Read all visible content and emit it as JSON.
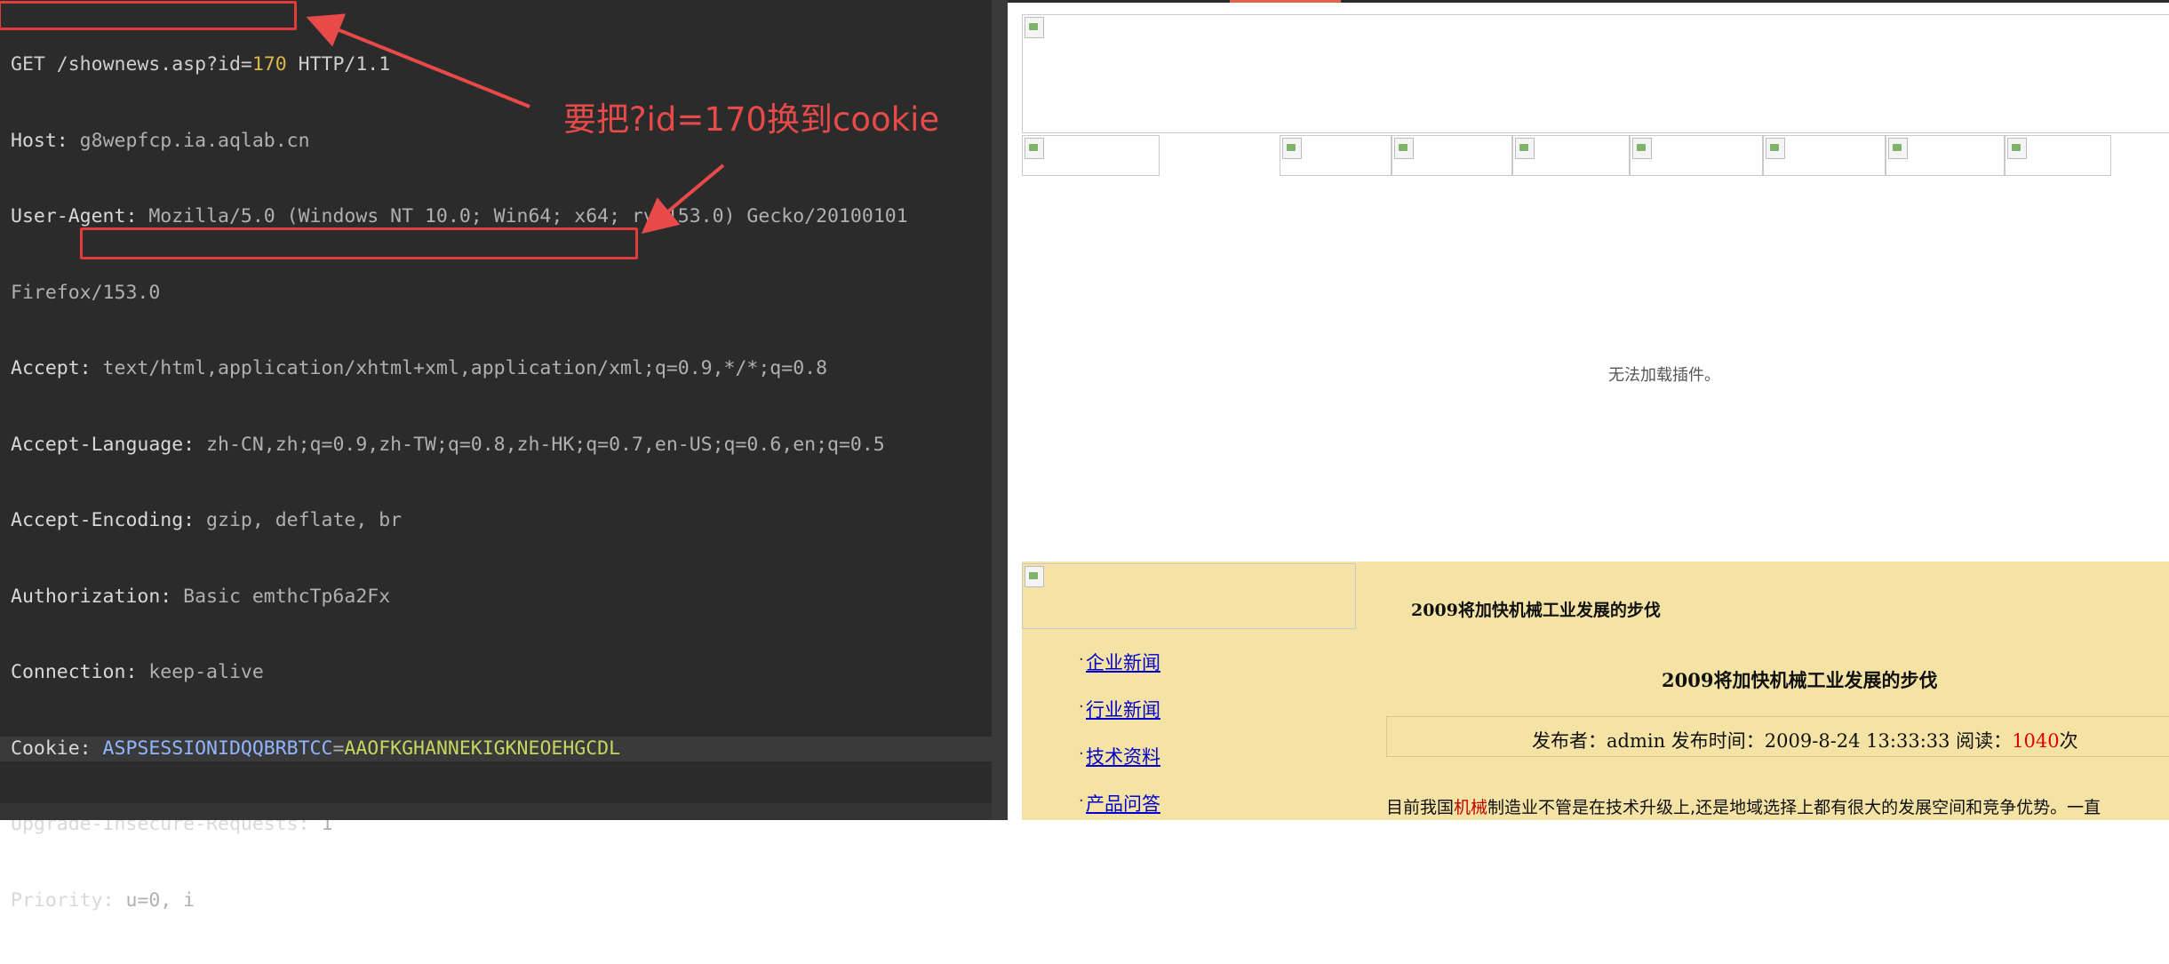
{
  "request": {
    "method": "GET",
    "path": "/shownews.asp?id=",
    "id_value": "170",
    "protocol": " HTTP/1.1",
    "headers": [
      {
        "name": "Host:",
        "value": " g8wepfcp.ia.aqlab.cn"
      },
      {
        "name": "User-Agent:",
        "value": " Mozilla/5.0 (Windows NT 10.0; Win64; x64; rv:153.0) Gecko/20100101"
      },
      {
        "name": "",
        "value": "Firefox/153.0"
      },
      {
        "name": "Accept:",
        "value": " text/html,application/xhtml+xml,application/xml;q=0.9,*/*;q=0.8"
      },
      {
        "name": "Accept-Language:",
        "value": " zh-CN,zh;q=0.9,zh-TW;q=0.8,zh-HK;q=0.7,en-US;q=0.6,en;q=0.5"
      },
      {
        "name": "Accept-Encoding:",
        "value": " gzip, deflate, br"
      },
      {
        "name": "Authorization:",
        "value": " Basic emthcTp6a2Fx"
      },
      {
        "name": "Connection:",
        "value": " keep-alive"
      }
    ],
    "cookie_label": "Cookie:",
    "cookie_name": " ASPSESSIONIDQQBRBTCC",
    "cookie_eq": "=",
    "cookie_value": "AAOFKGHANNEKIGKNEOEHGCDL",
    "after_headers": [
      {
        "name": "Upgrade-Insecure-Requests:",
        "value": " 1"
      },
      {
        "name": "Priority:",
        "value": " u=0, i"
      }
    ]
  },
  "annotation": {
    "text": "要把?id=170换到cookie",
    "color": "#e84a4a"
  },
  "webpage": {
    "plugin_message": "无法加载插件。",
    "sidebar_links": [
      "企业新闻",
      "行业新闻",
      "技术资料",
      "产品问答"
    ],
    "breadcrumb": "2009将加快机械工业发展的步伐",
    "article_title": "2009将加快机械工业发展的步伐",
    "meta_prefix": "发布者：admin 发布时间：2009-8-24 13:33:33 阅读：",
    "meta_reads": "1040",
    "meta_suffix": "次",
    "body_pre": "目前我国",
    "body_kw": "机械",
    "body_post": "制造业不管是在技术升级上,还是地域选择上都有很大的发展空间和竞争优势。一直"
  }
}
